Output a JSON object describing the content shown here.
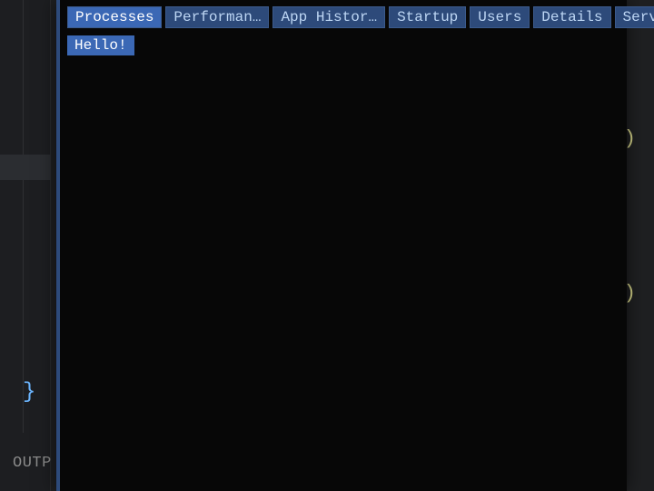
{
  "editor": {
    "hint_right_1": "\")",
    "hint_right_2": "\")",
    "brace": "}",
    "bottom_panel_label": "OUTP"
  },
  "modal": {
    "tabs": [
      {
        "label": "Processes"
      },
      {
        "label": "Performan…"
      },
      {
        "label": "App Histor…"
      },
      {
        "label": "Startup"
      },
      {
        "label": "Users"
      },
      {
        "label": "Details"
      },
      {
        "label": "Services"
      }
    ],
    "active_tab_index": 0,
    "content_text": "Hello!"
  }
}
